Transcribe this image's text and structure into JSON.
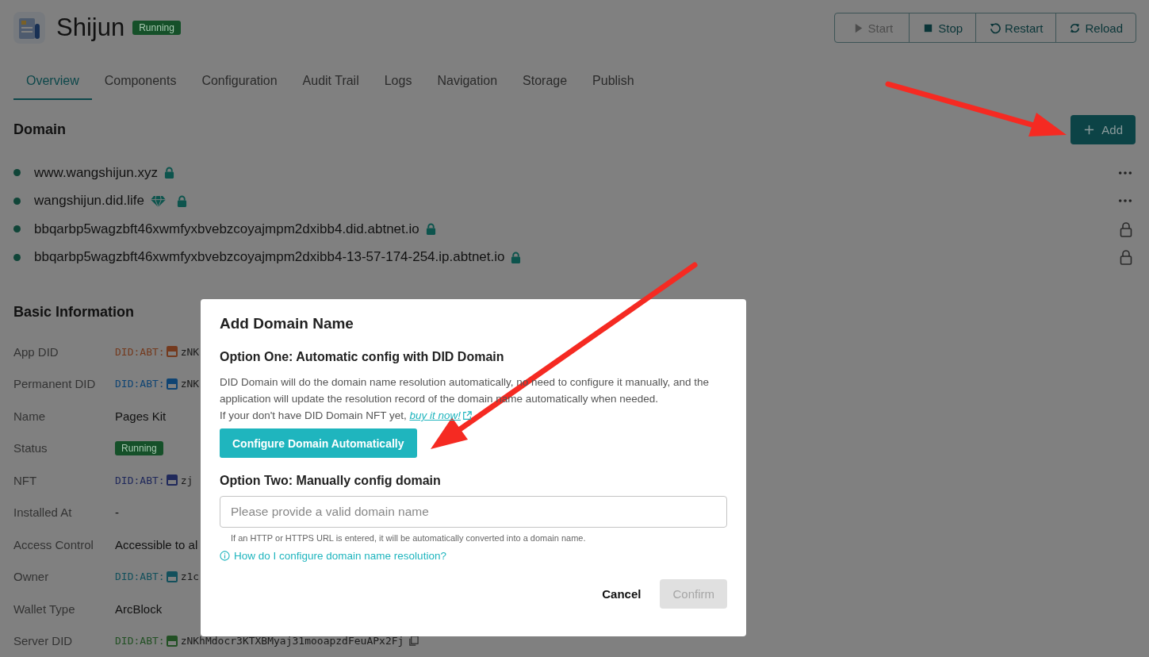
{
  "app": {
    "title": "Shijun",
    "status": "Running"
  },
  "actions": [
    {
      "label": "Start",
      "disabled": true
    },
    {
      "label": "Stop",
      "disabled": false
    },
    {
      "label": "Restart",
      "disabled": false
    },
    {
      "label": "Reload",
      "disabled": false
    }
  ],
  "tabs": [
    {
      "label": "Overview",
      "selected": true
    },
    {
      "label": "Components",
      "selected": false
    },
    {
      "label": "Configuration",
      "selected": false
    },
    {
      "label": "Audit Trail",
      "selected": false
    },
    {
      "label": "Logs",
      "selected": false
    },
    {
      "label": "Navigation",
      "selected": false
    },
    {
      "label": "Storage",
      "selected": false
    },
    {
      "label": "Publish",
      "selected": false
    }
  ],
  "domain": {
    "title": "Domain",
    "add_button": "Add",
    "items": [
      {
        "name": "www.wangshijun.xyz",
        "nft": false,
        "kind": "more"
      },
      {
        "name": "wangshijun.did.life",
        "nft": true,
        "kind": "more"
      },
      {
        "name": "bbqarbp5wagzbft46xwmfyxbvebzcoyajmpm2dxibb4.did.abtnet.io",
        "nft": false,
        "kind": "locked"
      },
      {
        "name": "bbqarbp5wagzbft46xwmfyxbvebzcoyajmpm2dxibb4-13-57-174-254.ip.abtnet.io",
        "nft": false,
        "kind": "locked"
      }
    ]
  },
  "basic_info": {
    "title": "Basic Information",
    "rows": [
      {
        "label": "App DID",
        "kind": "did",
        "prefix": "DID:ABT:",
        "value": "zNK",
        "color": "#743a1e"
      },
      {
        "label": "Permanent DID",
        "kind": "did",
        "prefix": "DID:ABT:",
        "value": "zNK",
        "color": "#0f4473"
      },
      {
        "label": "Name",
        "kind": "text",
        "value": "Pages Kit"
      },
      {
        "label": "Status",
        "kind": "badge",
        "value": "Running"
      },
      {
        "label": "NFT",
        "kind": "did",
        "prefix": "DID:ABT:",
        "value": "zj",
        "color": "#20295b"
      },
      {
        "label": "Installed At",
        "kind": "text",
        "value": "-"
      },
      {
        "label": "Access Control",
        "kind": "text",
        "value": "Accessible to al"
      },
      {
        "label": "Owner",
        "kind": "did",
        "prefix": "DID:ABT:",
        "value": "z1c",
        "color": "#13505c"
      },
      {
        "label": "Wallet Type",
        "kind": "text",
        "value": "ArcBlock"
      },
      {
        "label": "Server DID",
        "kind": "did",
        "prefix": "DID:ABT:",
        "value": "zNKhMdocr3KTXBMyaj31mooapzdFeuAPx2Fj",
        "color": "#225024",
        "copy": true
      }
    ]
  },
  "dialog": {
    "title": "Add Domain Name",
    "option_one": {
      "heading": "Option One: Automatic config with DID Domain",
      "description": "DID Domain will do the domain name resolution automatically, no need to configure it manually, and the application will update the resolution record of the domain name automatically when needed.",
      "nft_note": "If your don't have DID Domain NFT yet, ",
      "nft_link": "buy it now!",
      "button": "Configure Domain Automatically"
    },
    "option_two": {
      "heading": "Option Two: Manually config domain",
      "placeholder": "Please provide a valid domain name",
      "helper": "If an HTTP or HTTPS URL is entered, it will be automatically converted into a domain name.",
      "help_link": "How do I configure domain name resolution?"
    },
    "cancel": "Cancel",
    "confirm": {
      "label": "Confirm",
      "disabled": true
    }
  }
}
